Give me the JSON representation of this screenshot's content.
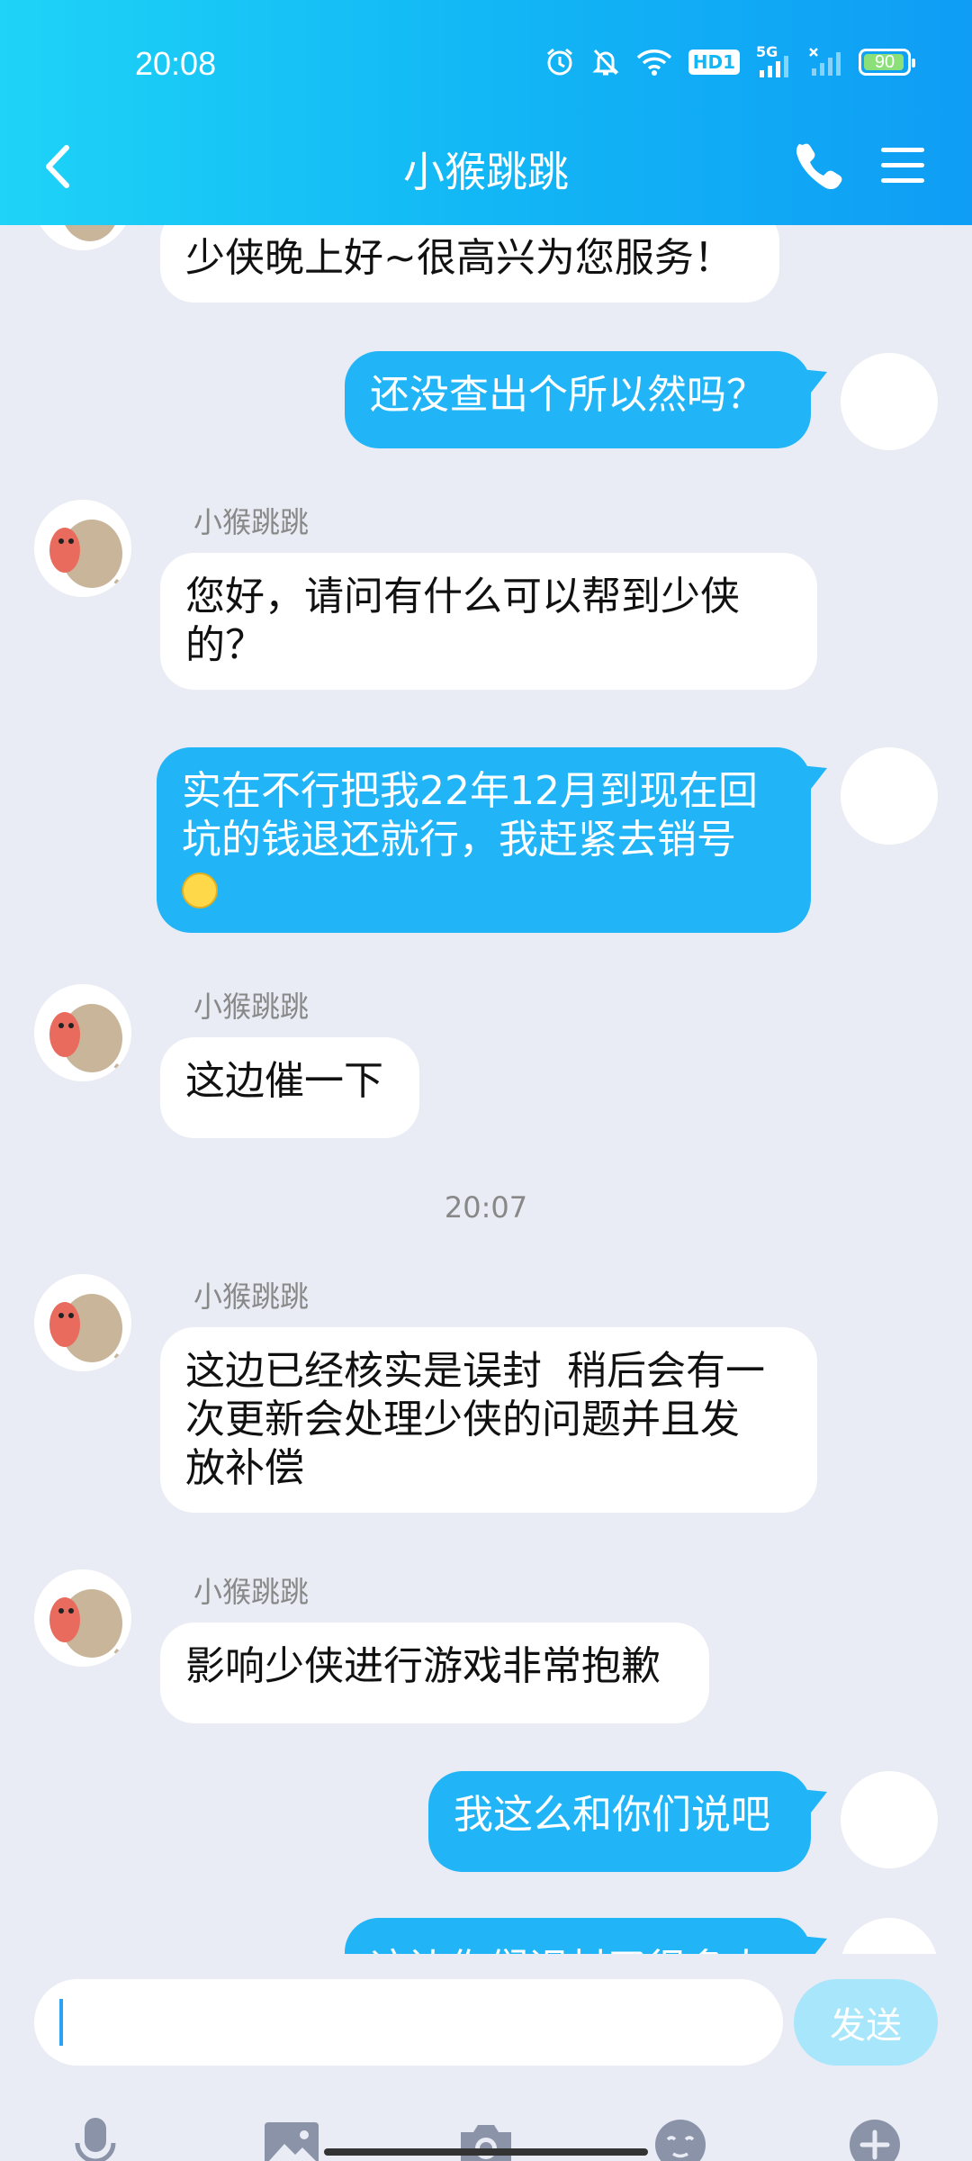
{
  "status_bar": {
    "time": "20:08",
    "battery": "90",
    "network": "5G",
    "hd": "HD1",
    "icons": [
      "alarm-icon",
      "mute-bell-icon",
      "wifi-icon",
      "hd-icon",
      "signal-icon",
      "signal-2-icon",
      "battery-icon"
    ]
  },
  "header": {
    "title": "小猴跳跳",
    "back_icon": "chevron-left-icon",
    "call_icon": "phone-icon",
    "menu_icon": "menu-icon"
  },
  "messages": [
    {
      "side": "in",
      "sender": "",
      "text": "少侠晚上好~很高兴为您服务！"
    },
    {
      "side": "out",
      "text": "还没查出个所以然吗？"
    },
    {
      "side": "in",
      "sender": "小猴跳跳",
      "text_line1": "您好，请问有什么可以帮到少侠",
      "text_line2": "的？"
    },
    {
      "side": "out",
      "text_line1": "实在不行把我22年12月到现在回",
      "text_line2": "坑的钱退还就行，我赶紧去销号",
      "emoji": "smile-emoji"
    },
    {
      "side": "in",
      "sender": "小猴跳跳",
      "text": "这边催一下"
    },
    {
      "type": "timestamp",
      "text": "20:07"
    },
    {
      "side": "in",
      "sender": "小猴跳跳",
      "text_line1": "这边已经核实是误封  稍后会有一",
      "text_line2": "次更新会处理少侠的问题并且发",
      "text_line3": "放补偿"
    },
    {
      "side": "in",
      "sender": "小猴跳跳",
      "text": "影响少侠进行游戏非常抱歉"
    },
    {
      "side": "out",
      "text": "我这么和你们说吧"
    },
    {
      "side": "out",
      "text": "这边你们误封了很多人"
    }
  ],
  "input": {
    "placeholder": "",
    "value": "",
    "send_label": "发送"
  },
  "toolbar": [
    "microphone-icon",
    "image-icon",
    "camera-icon",
    "emoji-icon",
    "plus-icon"
  ],
  "colors": {
    "header_gradient_start": "#1ED3F7",
    "header_gradient_end": "#0F9DF5",
    "outgoing_bubble": "#21B5F8",
    "incoming_bubble": "#FFFFFF",
    "background": "#E9ECF4",
    "send_disabled": "#A8E6FB"
  }
}
